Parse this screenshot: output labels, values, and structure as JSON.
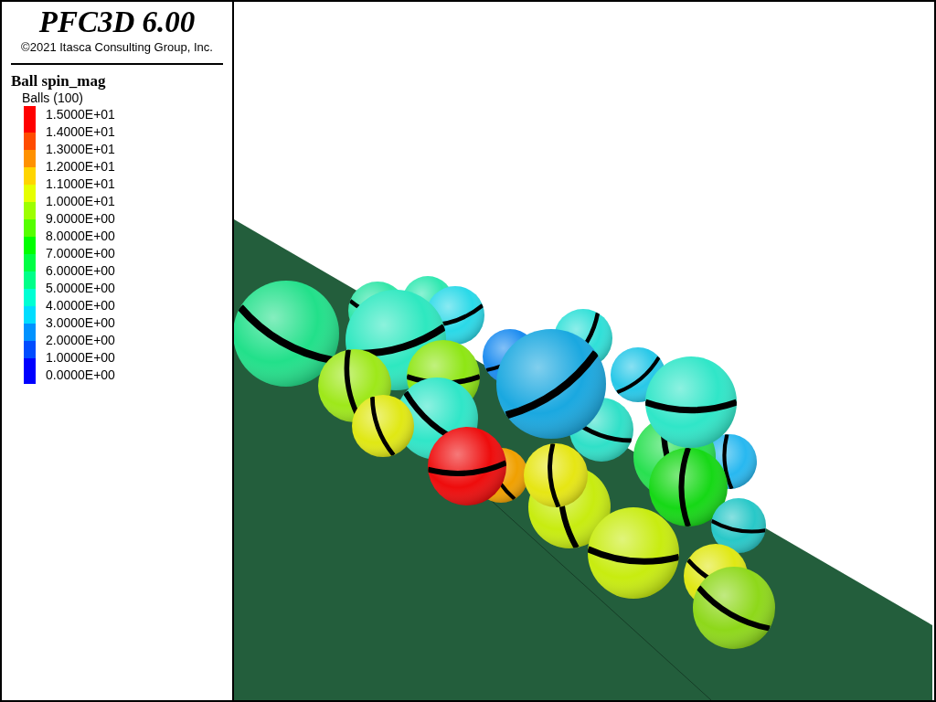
{
  "title": "PFC3D 6.00",
  "copyright": "©2021 Itasca Consulting Group, Inc.",
  "legend": {
    "title": "Ball spin_mag",
    "subtitle": "Balls (100)",
    "color_bands": [
      {
        "color": "#ff0000"
      },
      {
        "color": "#ff4c00"
      },
      {
        "color": "#ff9100"
      },
      {
        "color": "#ffd500"
      },
      {
        "color": "#e6ff00"
      },
      {
        "color": "#9dff00"
      },
      {
        "color": "#55ff00"
      },
      {
        "color": "#00ff00"
      },
      {
        "color": "#00ff44"
      },
      {
        "color": "#00ff88"
      },
      {
        "color": "#00ffd4"
      },
      {
        "color": "#00ddff"
      },
      {
        "color": "#0092ff"
      },
      {
        "color": "#004cff"
      },
      {
        "color": "#0000ff"
      }
    ],
    "scale_labels": [
      "1.5000E+01",
      "1.4000E+01",
      "1.3000E+01",
      "1.2000E+01",
      "1.1000E+01",
      "1.0000E+01",
      "9.0000E+00",
      "8.0000E+00",
      "7.0000E+00",
      "6.0000E+00",
      "5.0000E+00",
      "4.0000E+00",
      "3.0000E+00",
      "2.0000E+00",
      "1.0000E+00",
      "0.0000E+00"
    ]
  }
}
